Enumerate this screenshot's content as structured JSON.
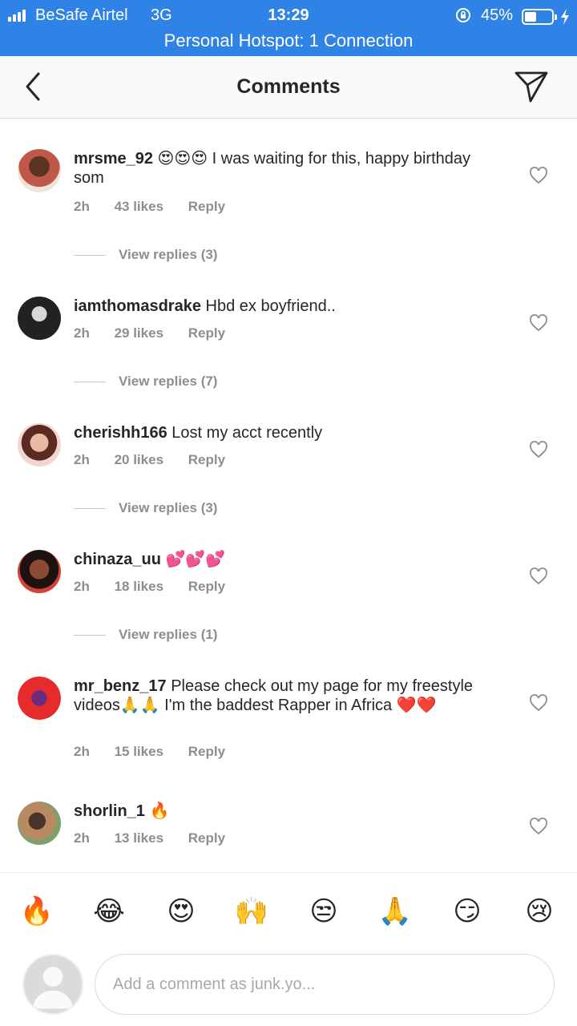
{
  "status_bar": {
    "carrier": "BeSafe Airtel",
    "network": "3G",
    "time": "13:29",
    "battery_pct": "45%",
    "battery_level": 0.45,
    "hotspot": "Personal Hotspot: 1 Connection",
    "bar_color": "#2f83e6"
  },
  "nav": {
    "title": "Comments",
    "back_icon": "chevron-left-icon",
    "send_icon": "paper-plane-icon"
  },
  "comments": [
    {
      "username": "mrsme_92",
      "text": "😍😍😍 I was waiting for this, happy birthday som",
      "time": "2h",
      "likes": "43 likes",
      "reply": "Reply",
      "view_replies": "View replies (3)"
    },
    {
      "username": "iamthomasdrake",
      "text": "Hbd ex boyfriend..",
      "time": "2h",
      "likes": "29 likes",
      "reply": "Reply",
      "view_replies": "View replies (7)"
    },
    {
      "username": "cherishh166",
      "text": "Lost my acct recently",
      "time": "2h",
      "likes": "20 likes",
      "reply": "Reply",
      "view_replies": "View replies (3)"
    },
    {
      "username": "chinaza_uu",
      "text": "💕💕💕",
      "time": "2h",
      "likes": "18 likes",
      "reply": "Reply",
      "view_replies": "View replies (1)"
    },
    {
      "username": "mr_benz_17",
      "text": "Please check out my page for my freestyle videos🙏🙏 I'm the baddest Rapper in Africa ❤️❤️",
      "time": "2h",
      "likes": "15 likes",
      "reply": "Reply"
    },
    {
      "username": "shorlin_1",
      "text": "🔥",
      "time": "2h",
      "likes": "13 likes",
      "reply": "Reply"
    }
  ],
  "emoji_bar": [
    "🔥",
    "😂",
    "😍",
    "🙌",
    "😒",
    "🙏",
    "😏",
    "😢"
  ],
  "comment_input": {
    "placeholder": "Add a comment as junk.yo..."
  },
  "colors": {
    "text": "#262626",
    "muted": "#8e8e8e",
    "divider": "#dbdbdb"
  }
}
